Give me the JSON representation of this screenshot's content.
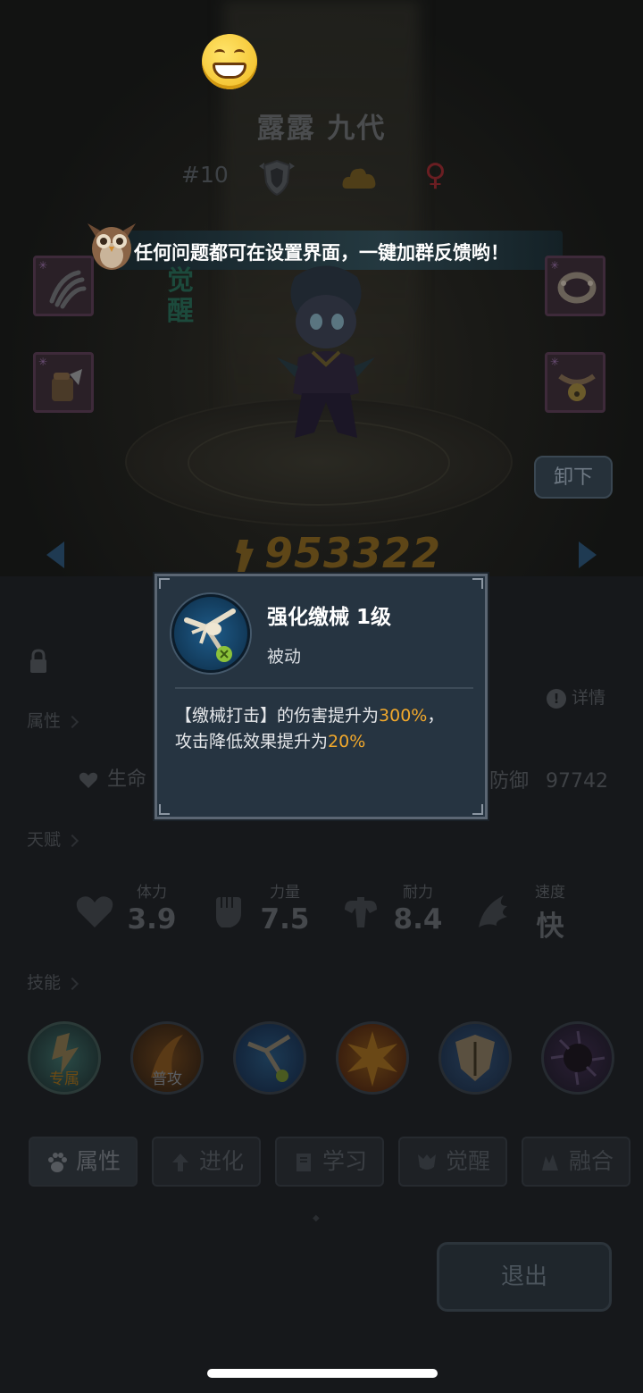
{
  "hero": {
    "name": "露露 九代",
    "rank": "#10",
    "gender_symbol": "♀",
    "awaken_label": "觉醒",
    "power": "953322"
  },
  "banner": {
    "message": "任何问题都可在设置界面，一键加群反馈哟！"
  },
  "actions": {
    "unequip": "卸下",
    "exit": "退出"
  },
  "sections": {
    "attributes": "属性",
    "talent": "天赋",
    "skills": "技能",
    "details": "详情"
  },
  "stats": {
    "hp_label": "生命",
    "def_label": "防御",
    "def_value": "97742"
  },
  "traits": [
    {
      "label": "体力",
      "value": "3.9",
      "icon": "heart-icon"
    },
    {
      "label": "力量",
      "value": "7.5",
      "icon": "fist-icon"
    },
    {
      "label": "耐力",
      "value": "8.4",
      "icon": "muscle-icon"
    },
    {
      "label": "速度",
      "value": "快",
      "icon": "wing-icon"
    }
  ],
  "skills": [
    {
      "label": "专属",
      "icon": "exclusive-skill-icon"
    },
    {
      "label": "普攻",
      "icon": "basic-attack-icon"
    },
    {
      "label": "",
      "icon": "cable-strike-icon"
    },
    {
      "label": "",
      "icon": "explosion-skill-icon"
    },
    {
      "label": "",
      "icon": "armor-skill-icon"
    },
    {
      "label": "",
      "icon": "dark-burst-icon"
    }
  ],
  "tabs": [
    {
      "label": "属性",
      "icon": "paw-icon",
      "active": true
    },
    {
      "label": "进化",
      "icon": "evolve-icon",
      "active": false
    },
    {
      "label": "学习",
      "icon": "book-icon",
      "active": false
    },
    {
      "label": "觉醒",
      "icon": "awaken-icon",
      "active": false
    },
    {
      "label": "融合",
      "icon": "fusion-icon",
      "active": false
    }
  ],
  "popup": {
    "title": "强化缴械 1级",
    "type": "被动",
    "desc_prefix": "【缴械打击】的伤害提升为",
    "desc_value1": "300%",
    "desc_mid": "，",
    "desc_line2_prefix": "攻击降低效果提升为",
    "desc_value2": "20%"
  },
  "colors": {
    "highlight": "#f2a92c",
    "popup_bg": "#263441",
    "power_gold": "#5e4617"
  }
}
